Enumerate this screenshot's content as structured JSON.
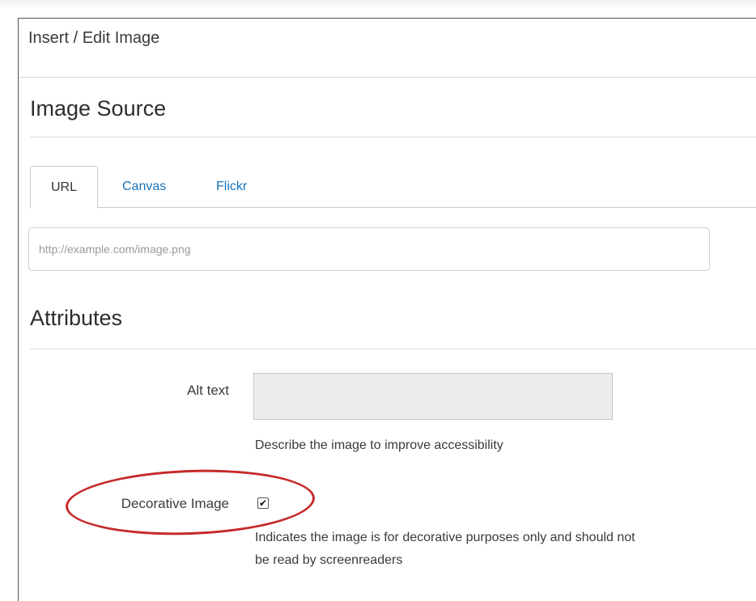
{
  "dialog": {
    "title": "Insert / Edit Image"
  },
  "image_source": {
    "heading": "Image Source",
    "tabs": [
      {
        "label": "URL",
        "active": true
      },
      {
        "label": "Canvas",
        "active": false
      },
      {
        "label": "Flickr",
        "active": false
      }
    ],
    "url_placeholder": "http://example.com/image.png",
    "url_value": ""
  },
  "attributes": {
    "heading": "Attributes",
    "alt_text_label": "Alt text",
    "alt_text_value": "",
    "alt_text_help": "Describe the image to improve accessibility",
    "decorative_label": "Decorative Image",
    "decorative_checked": true,
    "decorative_help_line1": "Indicates the image is for decorative purposes only and should not",
    "decorative_help_line2": "be read by screenreaders"
  },
  "annotation": {
    "highlight_color": "#c62a2a"
  },
  "colors": {
    "link": "#1a73b8"
  }
}
